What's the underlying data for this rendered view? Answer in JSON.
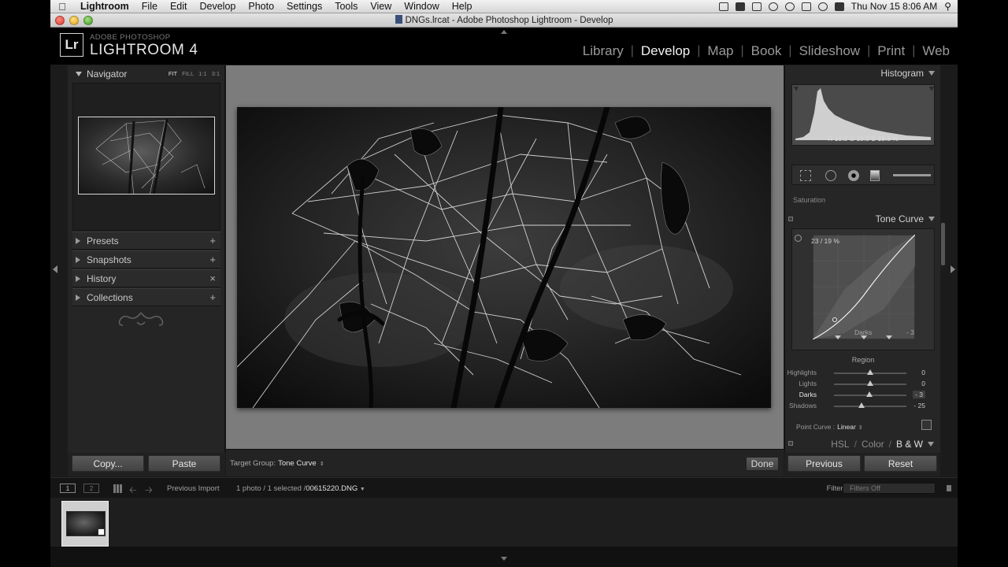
{
  "menubar": {
    "app_name": "Lightroom",
    "items": [
      "File",
      "Edit",
      "Develop",
      "Photo",
      "Settings",
      "Tools",
      "View",
      "Window",
      "Help"
    ],
    "clock": "Thu Nov 15  8:06 AM"
  },
  "window": {
    "title": "DNGs.lrcat - Adobe Photoshop Lightroom - Develop"
  },
  "identity": {
    "logo": "Lr",
    "line1": "ADOBE PHOTOSHOP",
    "line2": "LIGHTROOM 4"
  },
  "modules": {
    "items": [
      "Library",
      "Develop",
      "Map",
      "Book",
      "Slideshow",
      "Print",
      "Web"
    ],
    "active": "Develop"
  },
  "left_panel": {
    "navigator": {
      "title": "Navigator",
      "zoom_options": [
        "FIT",
        "FILL",
        "1:1",
        "3:1"
      ]
    },
    "sections": [
      {
        "label": "Presets",
        "button": "+"
      },
      {
        "label": "Snapshots",
        "button": "+"
      },
      {
        "label": "History",
        "button": "×"
      },
      {
        "label": "Collections",
        "button": "+"
      }
    ],
    "copy_button": "Copy...",
    "paste_button": "Paste"
  },
  "toolbar": {
    "target_group_label": "Target Group:",
    "target_group_value": "Tone Curve",
    "done_button": "Done"
  },
  "right_panel": {
    "histogram": {
      "title": "Histogram",
      "readout": "R  19.8  G  19.8  B  19.8 %"
    },
    "saturation_label": "Saturation",
    "tone_curve": {
      "title": "Tone Curve",
      "readout": "23 / 19 %",
      "hover_region": "Darks",
      "hover_value": "- 3",
      "region_title": "Region",
      "sliders": [
        {
          "label": "Highlights",
          "value": "0",
          "level": 0.5
        },
        {
          "label": "Lights",
          "value": "0",
          "level": 0.5
        },
        {
          "label": "Darks",
          "value": "- 3",
          "level": 0.485,
          "active": true
        },
        {
          "label": "Shadows",
          "value": "- 25",
          "level": 0.375
        }
      ],
      "point_curve_label": "Point Curve :",
      "point_curve_value": "Linear"
    },
    "hsl_tabs": [
      "HSL",
      "Color",
      "B & W"
    ],
    "hsl_active": "B & W",
    "previous_button": "Previous",
    "reset_button": "Reset"
  },
  "filmstrip": {
    "monitor_1": "1",
    "monitor_2": "2",
    "source": "Previous Import",
    "status": "1 photo / 1 selected /",
    "filename": "00615220.DNG",
    "filter_label": "Filter :",
    "filter_value": "Filters Off"
  }
}
